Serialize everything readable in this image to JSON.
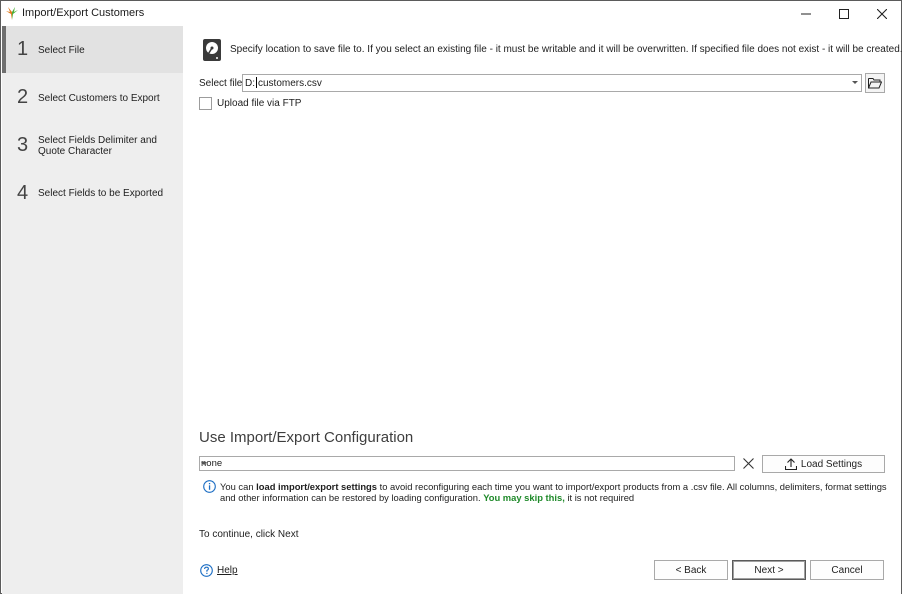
{
  "window": {
    "title": "Import/Export Customers"
  },
  "sidebar": {
    "steps": [
      {
        "num": "1",
        "label": "Select File",
        "active": true
      },
      {
        "num": "2",
        "label": "Select Customers to Export",
        "active": false
      },
      {
        "num": "3",
        "label": "Select Fields Delimiter and Quote Character",
        "active": false
      },
      {
        "num": "4",
        "label": "Select Fields to be Exported",
        "active": false
      }
    ]
  },
  "main": {
    "instruction": "Specify location to save file to. If you select an existing file - it must be writable and it will be overwritten. If specified file does not exist - it will be created.",
    "select_file_label": "Select file",
    "file_value_prefix": "D:",
    "file_value_suffix": "customers.csv",
    "ftp_label": "Upload file via FTP",
    "ftp_checked": false
  },
  "config": {
    "title": "Use Import/Export Configuration",
    "selected": "none",
    "load_button": "Load Settings",
    "info_part1": "You can ",
    "info_bold": "load import/export settings",
    "info_part2": " to avoid reconfiguring each time you want to import/export products from a .csv file. All columns, delimiters, format settings and other information can be restored by loading configuration. ",
    "info_green": "You may skip this,",
    "info_part3": " it is not required"
  },
  "footer": {
    "continue_text": "To continue, click Next",
    "help": "Help",
    "back": "< Back",
    "next": "Next >",
    "cancel": "Cancel"
  },
  "colors": {
    "sidebar_bg": "#eeeeee",
    "active_step_bg": "#e2e2e2",
    "green_text": "#1f8a2a",
    "info_blue": "#1e6fc4"
  }
}
